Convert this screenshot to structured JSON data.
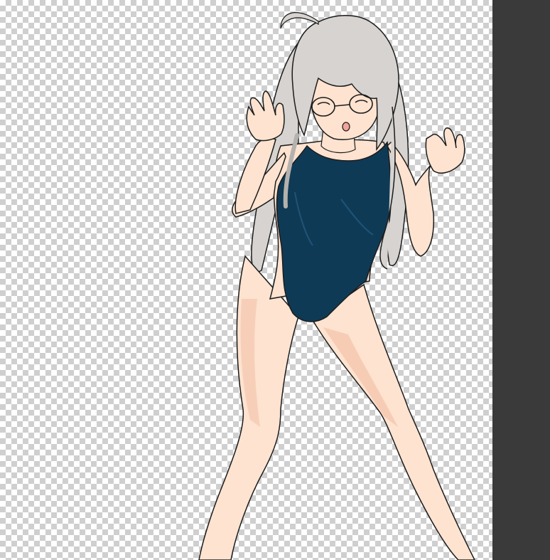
{
  "canvas": {
    "layer_content": "character-artwork",
    "transparency": "checkerboard"
  },
  "colors": {
    "panel_bg": "#3a3a3a",
    "checker_light": "#ffffff",
    "checker_dark": "#cfcfcf",
    "skin": "#fde3d0",
    "skin_shadow": "#f4c2aa",
    "hair": "#d6d3d0",
    "hair_shadow": "#b5b1ad",
    "swimsuit": "#0f3a55",
    "outline": "#1c1c1c"
  }
}
